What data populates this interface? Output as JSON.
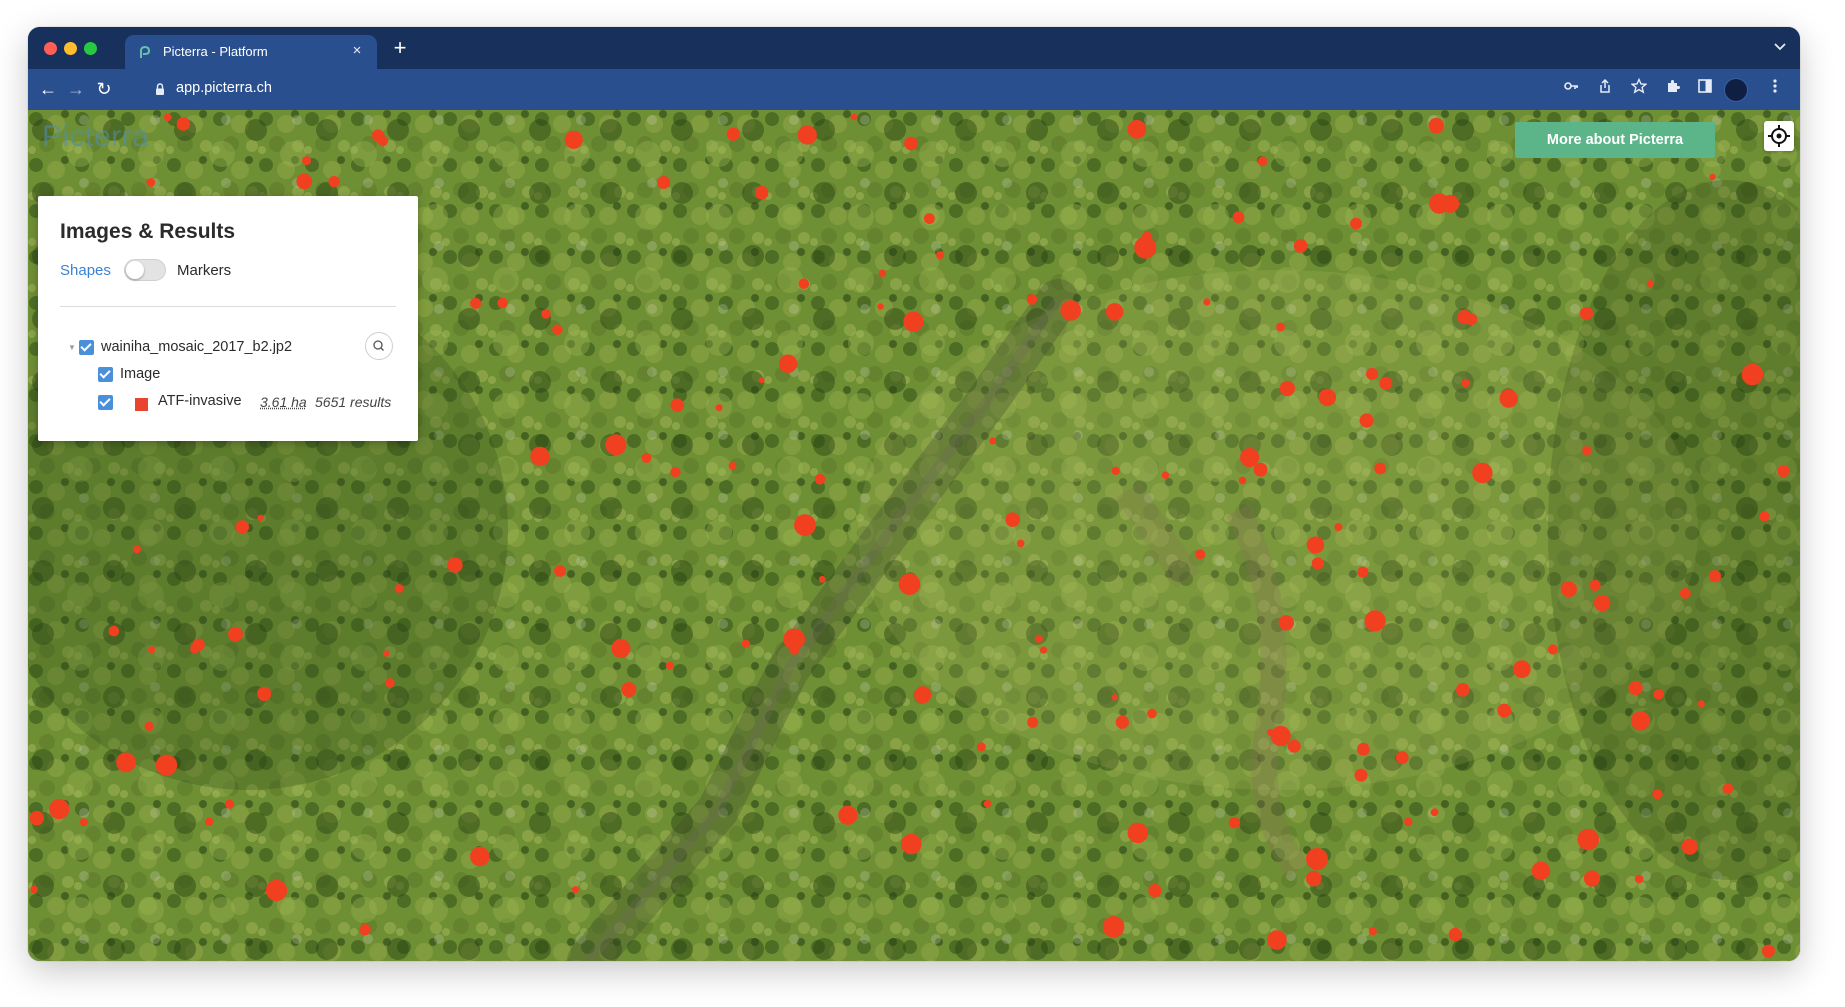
{
  "browser": {
    "tab_title": "Picterra - Platform",
    "tab_close": "×",
    "new_tab": "+",
    "tab_dropdown": "⌄",
    "url": "app.picterra.ch",
    "nav_back": "←",
    "nav_forward": "→",
    "nav_reload": "↻",
    "toolbar_icons": [
      "key-icon",
      "share-icon",
      "star-icon",
      "extensions-icon",
      "sidepanel-icon",
      "profile-avatar",
      "menu-icon"
    ]
  },
  "map": {
    "brand": "Picterra",
    "cta_label": "More about Picterra",
    "locate_icon": "crosshair-icon",
    "marker_color": "#f0401f"
  },
  "panel": {
    "title": "Images & Results",
    "toggle_left": "Shapes",
    "toggle_right": "Markers",
    "toggle_on": false,
    "image_file": "wainiha_mosaic_2017_b2.jp2",
    "image_layer": "Image",
    "result_layer": "ATF-invasive",
    "result_area": "3.61 ha",
    "result_count": "5651 results",
    "result_color": "#e9442d"
  }
}
